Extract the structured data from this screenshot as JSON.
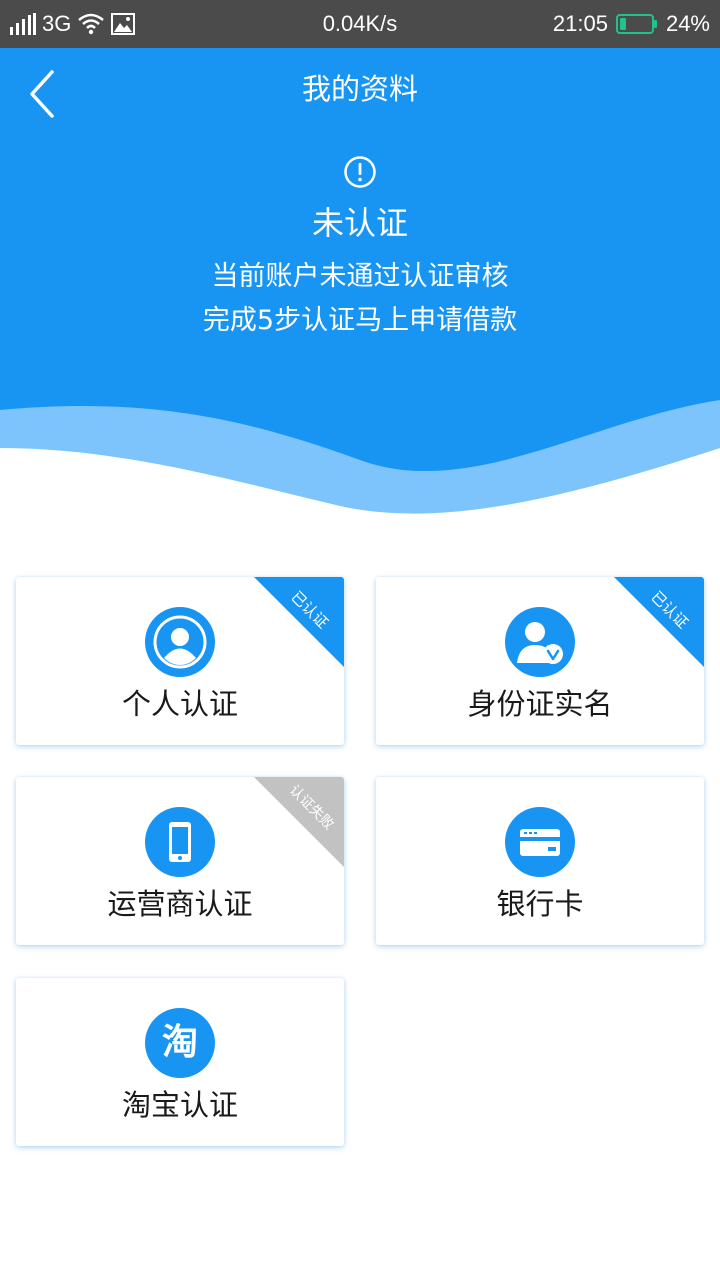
{
  "status_bar": {
    "network": "3G",
    "speed": "0.04K/s",
    "time": "21:05",
    "battery": "24%"
  },
  "header": {
    "title": "我的资料",
    "status_title": "未认证",
    "status_line1": "当前账户未通过认证审核",
    "status_line2": "完成5步认证马上申请借款"
  },
  "cards": [
    {
      "label": "个人认证",
      "badge": "已认证",
      "icon": "user-icon"
    },
    {
      "label": "身份证实名",
      "badge": "已认证",
      "icon": "id-verified-icon"
    },
    {
      "label": "运营商认证",
      "badge": "认证失败",
      "icon": "phone-icon"
    },
    {
      "label": "银行卡",
      "badge": "",
      "icon": "bank-card-icon"
    },
    {
      "label": "淘宝认证",
      "badge": "",
      "icon": "taobao-icon",
      "icon_text": "淘"
    }
  ],
  "colors": {
    "primary": "#1895f2",
    "status_bar": "#4b4b4b",
    "badge_verified": "#1895f2",
    "badge_failed": "#c2c2c2"
  }
}
